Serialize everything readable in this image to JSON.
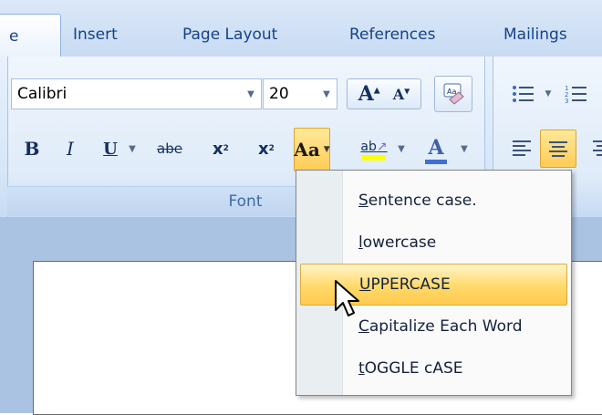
{
  "tabs": [
    {
      "label": "e",
      "active": true
    },
    {
      "label": "Insert",
      "active": false
    },
    {
      "label": "Page Layout",
      "active": false
    },
    {
      "label": "References",
      "active": false
    },
    {
      "label": "Mailings",
      "active": false
    }
  ],
  "font_group": {
    "font_name": "Calibri",
    "font_size": "20",
    "label": "Font",
    "grow_font": "A",
    "shrink_font": "A",
    "bold": "B",
    "italic": "I",
    "underline": "U",
    "strikethrough": "abe",
    "subscript": "x",
    "superscript": "x",
    "change_case": "Aa",
    "highlight": "ab",
    "font_color": "A"
  },
  "change_case_menu": {
    "items": [
      {
        "accel": "S",
        "rest": "entence case.",
        "highlighted": false
      },
      {
        "accel": "l",
        "rest": "owercase",
        "highlighted": false
      },
      {
        "accel": "U",
        "rest": "PPERCASE",
        "highlighted": true
      },
      {
        "accel": "C",
        "rest": "apitalize Each Word",
        "highlighted": false
      },
      {
        "accel": "t",
        "rest": "OGGLE cASE",
        "highlighted": false
      }
    ]
  },
  "colors": {
    "accent": "#ffcc55",
    "tab_text": "#15428b",
    "ribbon": "#dfebf9"
  }
}
